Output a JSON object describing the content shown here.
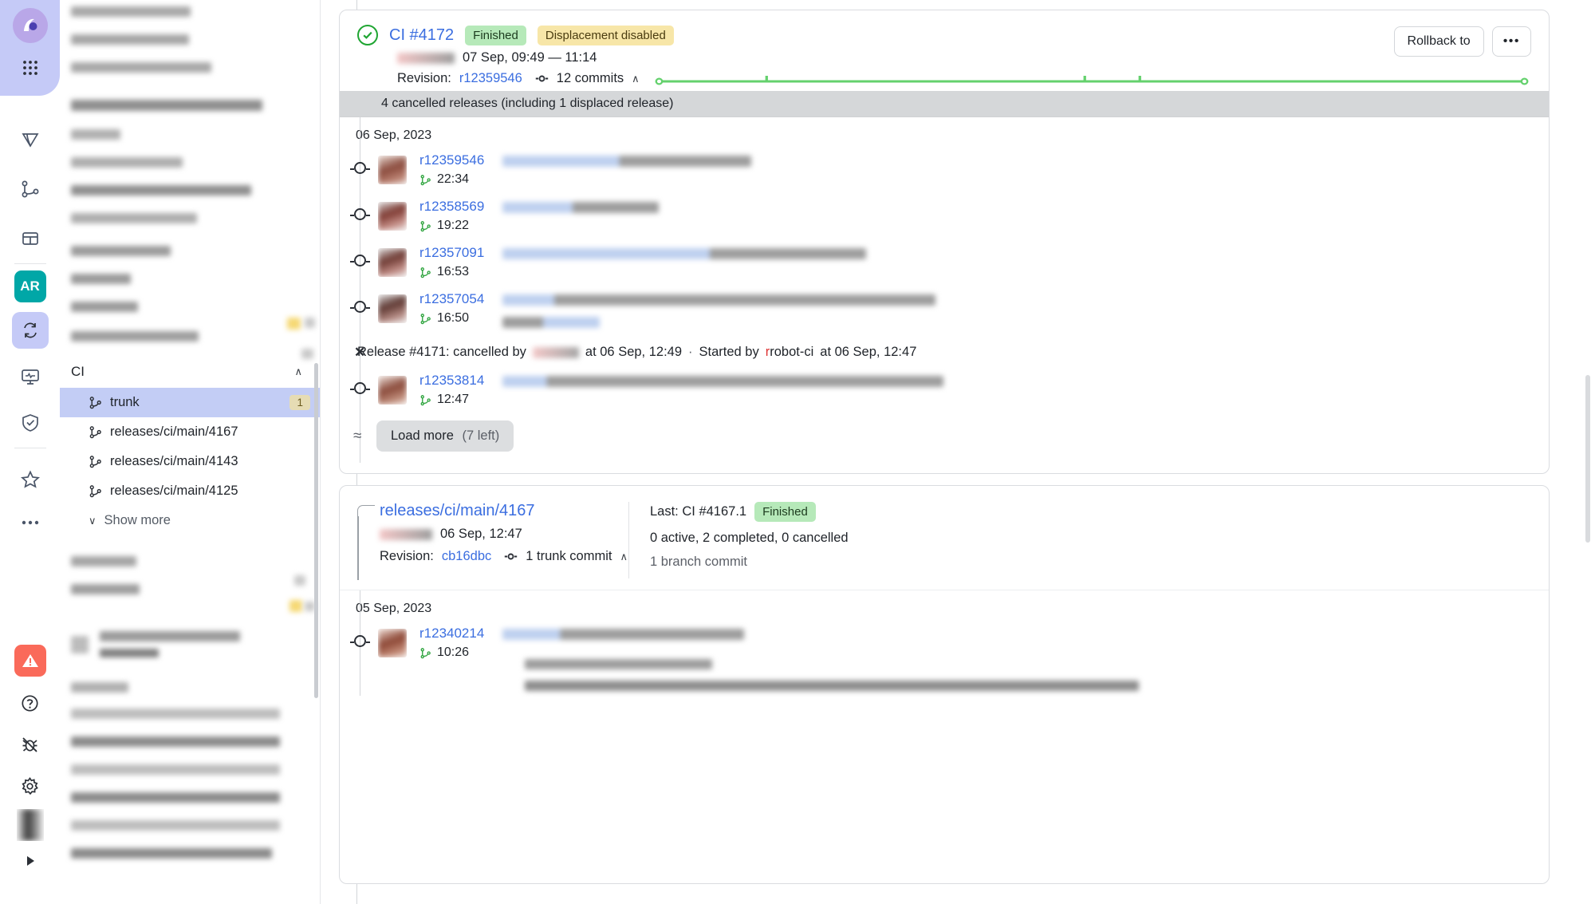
{
  "rail": {
    "items": [
      {
        "name": "app-logo",
        "label": "logo"
      },
      {
        "name": "apps-grid-icon",
        "label": "grid"
      },
      {
        "name": "rocket-icon",
        "label": "rocket"
      },
      {
        "name": "branches-icon",
        "label": "branches"
      },
      {
        "name": "board-icon",
        "label": "board"
      },
      {
        "name": "avatar-ar",
        "label": "AR"
      },
      {
        "name": "ci-icon",
        "label": "ci"
      },
      {
        "name": "monitoring-icon",
        "label": "monitoring"
      },
      {
        "name": "shield-icon",
        "label": "security"
      },
      {
        "name": "star-icon",
        "label": "favorites"
      },
      {
        "name": "more-icon",
        "label": "more"
      },
      {
        "name": "alert-icon",
        "label": "alerts"
      },
      {
        "name": "help-icon",
        "label": "help"
      },
      {
        "name": "bug-icon",
        "label": "bug"
      },
      {
        "name": "settings-icon",
        "label": "settings"
      },
      {
        "name": "user-avatar",
        "label": "user"
      },
      {
        "name": "collapse-icon",
        "label": "expand"
      }
    ]
  },
  "sidebar": {
    "section": {
      "title": "CI",
      "collapse_icon": "∧"
    },
    "items": [
      {
        "label": "trunk",
        "badge": "1",
        "active": true
      },
      {
        "label": "releases/ci/main/4167",
        "badge": "",
        "active": false
      },
      {
        "label": "releases/ci/main/4143",
        "badge": "",
        "active": false
      },
      {
        "label": "releases/ci/main/4125",
        "badge": "",
        "active": false
      }
    ],
    "show_more": "Show more",
    "show_more_icon": "∨"
  },
  "release_card": {
    "status_icon": "check-circle",
    "title": "CI #4172",
    "chips": [
      {
        "label": "Finished",
        "color": "#b6e9b9"
      },
      {
        "label": "Displacement disabled",
        "color": "#f7e6a8"
      }
    ],
    "actions": {
      "rollback_label": "Rollback to",
      "more_label": "•••"
    },
    "timestamp": "07 Sep, 09:49 — 11:14",
    "revision_label": "Revision:",
    "revision_value": "r12359546",
    "commits_label": "12 commits",
    "commits_chevron": "∧",
    "cancelled_banner": "4 cancelled releases (including 1 displaced release)",
    "date_group": "06 Sep, 2023",
    "commits": [
      {
        "revision": "r12359546",
        "time": "22:34"
      },
      {
        "revision": "r12358569",
        "time": "19:22"
      },
      {
        "revision": "r12357091",
        "time": "16:53"
      },
      {
        "revision": "r12357054",
        "time": "16:50"
      }
    ],
    "cancel_notice": {
      "prefix": "Release #4171: cancelled by",
      "at": "at 06 Sep, 12:49",
      "separator": "·",
      "started_by_label": "Started by",
      "started_by_user": "robot-ci",
      "started_at": "at 06 Sep, 12:47"
    },
    "cancelled_commit": {
      "revision": "r12353814",
      "time": "12:47"
    },
    "load_more": {
      "label": "Load more",
      "count": "(7 left)"
    }
  },
  "branch_card": {
    "title": "releases/ci/main/4167",
    "timestamp": "06 Sep, 12:47",
    "revision_label": "Revision:",
    "revision_value": "cb16dbc",
    "commits_label": "1 trunk commit",
    "commits_chevron": "∧",
    "last_label": "Last: CI #4167.1",
    "last_status": "Finished",
    "counts": "0 active, 2 completed, 0 cancelled",
    "branch_commits": "1 branch commit",
    "date_group": "05 Sep, 2023",
    "commits": [
      {
        "revision": "r12340214",
        "time": "10:26"
      }
    ]
  },
  "colors": {
    "link": "#3b6ee0",
    "success": "#1fa532",
    "timeline": "#64d16d",
    "accent": "#c5caf7",
    "warning": "#fa6a5a"
  }
}
